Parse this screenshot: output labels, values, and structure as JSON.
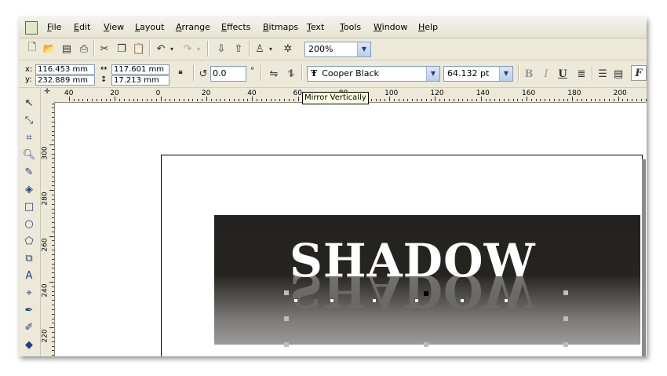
{
  "menu": {
    "items": [
      {
        "id": "file",
        "label": "File"
      },
      {
        "id": "edit",
        "label": "Edit"
      },
      {
        "id": "view",
        "label": "View"
      },
      {
        "id": "layout",
        "label": "Layout"
      },
      {
        "id": "arrange",
        "label": "Arrange"
      },
      {
        "id": "effects",
        "label": "Effects"
      },
      {
        "id": "bitmaps",
        "label": "Bitmaps"
      },
      {
        "id": "text",
        "label": "Text"
      },
      {
        "id": "tools",
        "label": "Tools"
      },
      {
        "id": "window",
        "label": "Window"
      },
      {
        "id": "help",
        "label": "Help"
      }
    ]
  },
  "standard_toolbar": {
    "zoom_value": "200%"
  },
  "property_bar": {
    "x_label": "x:",
    "y_label": "y:",
    "x_value": "116.453 mm",
    "y_value": "232.889 mm",
    "width_value": "117.601 mm",
    "height_value": "17.213 mm",
    "rotation_value": "0.0",
    "rotation_unit": "°",
    "font_name": "Cooper Black",
    "font_icon": "Ŧ",
    "font_size": "64.132 pt",
    "bold_label": "B",
    "italic_label": "I",
    "underline_label": "U"
  },
  "tooltip": {
    "text": "Mirror Vertically"
  },
  "ruler": {
    "h_labels": [
      "40",
      "20",
      "0",
      "20",
      "40",
      "60",
      "80",
      "100",
      "120",
      "140",
      "160",
      "180",
      "200"
    ],
    "v_labels": [
      "300",
      "280",
      "260",
      "240",
      "220"
    ]
  },
  "artwork": {
    "text": "SHADOW",
    "reflection_text": "SHADOW"
  }
}
